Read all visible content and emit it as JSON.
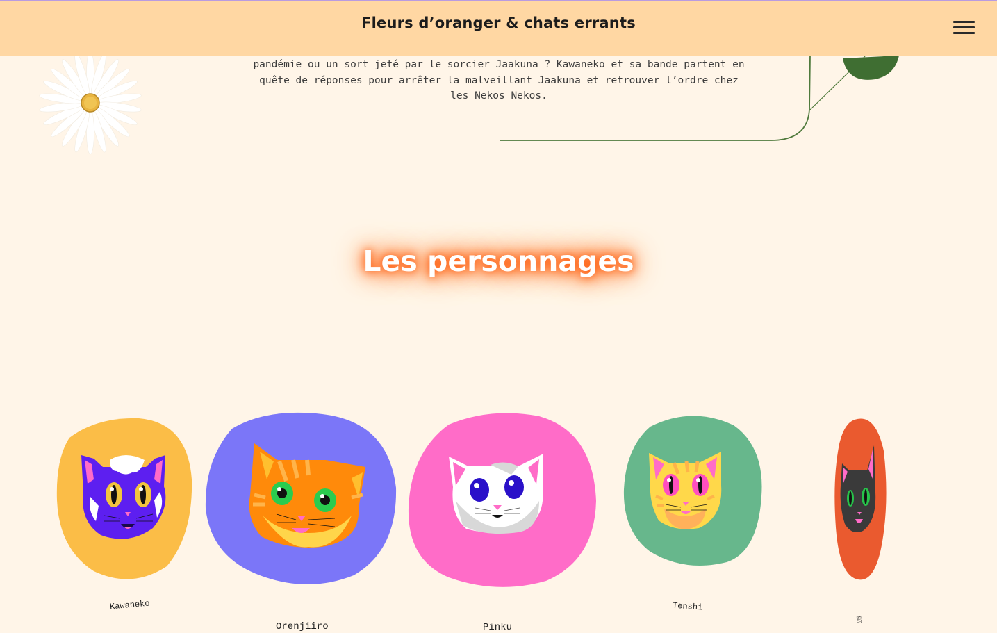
{
  "header": {
    "title": "Fleurs d’oranger & chats errants",
    "menu_icon": "hamburger-menu-icon"
  },
  "intro": {
    "text": "pandémie ou un sort jeté par le sorcier Jaakuna ? Kawaneko et sa bande partent en quête de réponses pour arrêter la malveillant Jaakuna et retrouver l’ordre chez les Nekos Nekos."
  },
  "characters_section": {
    "title": "Les personnages",
    "characters": [
      {
        "name": "Kawaneko",
        "blob_color": "#fbbd47",
        "cat": "purple-cat-icon"
      },
      {
        "name": "Orenjiiro",
        "blob_color": "#7b76f8",
        "cat": "orange-tabby-cat-icon"
      },
      {
        "name": "Pinku",
        "blob_color": "#ff6cc8",
        "cat": "white-cat-icon"
      },
      {
        "name": "Tenshi",
        "blob_color": "#67b78c",
        "cat": "yellow-cat-icon"
      },
      {
        "name": "Kuro",
        "blob_color": "#ea5a2f",
        "cat": "black-cat-icon"
      }
    ]
  },
  "decor": {
    "daisy": "daisy-flower-icon",
    "vine": "leaf-vine-icon"
  },
  "colors": {
    "header_bg": "#ffd7a3",
    "page_bg": "#fff5e8",
    "title_glow": "#ff5a0a"
  }
}
